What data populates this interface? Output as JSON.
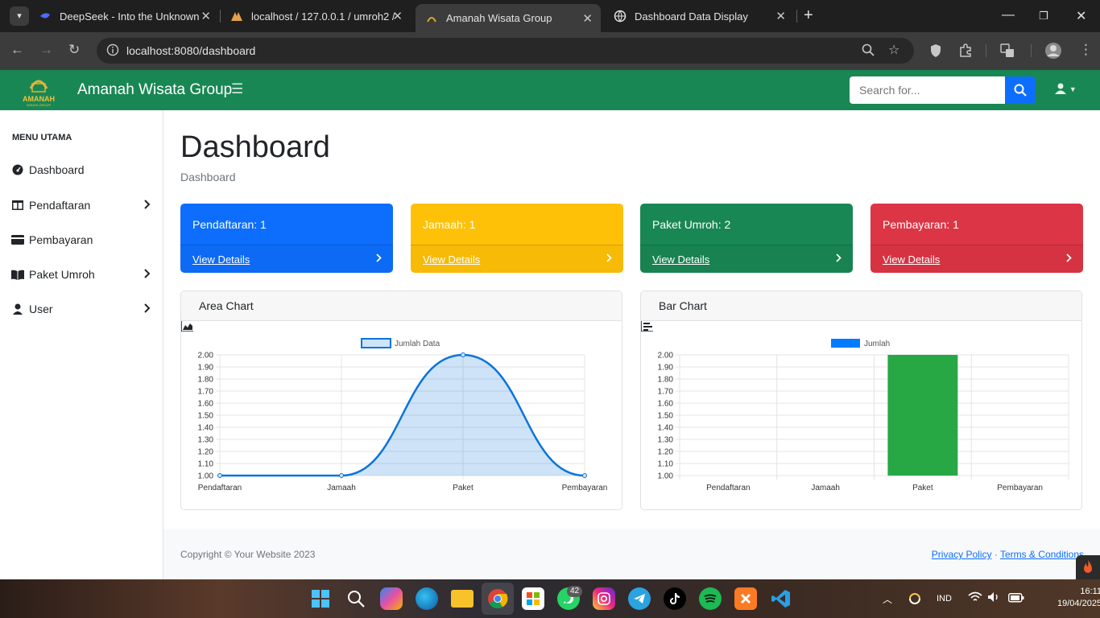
{
  "browser": {
    "tabs": [
      {
        "title": "DeepSeek - Into the Unknown",
        "icon": "deepseek-icon"
      },
      {
        "title": "localhost / 127.0.0.1 / umroh2 /",
        "icon": "phpmyadmin-icon"
      },
      {
        "title": "Amanah Wisata Group",
        "icon": "amanah-icon",
        "active": true
      },
      {
        "title": "Dashboard Data Display",
        "icon": "globe-icon"
      }
    ],
    "url": "localhost:8080/dashboard"
  },
  "navbar": {
    "brand_logo_text": "AMANAH",
    "brand_logo_sub": "WISATA GROUP",
    "brand": "Amanah Wisata Group",
    "search_placeholder": "Search for..."
  },
  "sidebar": {
    "heading": "MENU UTAMA",
    "items": [
      {
        "label": "Dashboard",
        "icon": "dashboard-icon",
        "expandable": false
      },
      {
        "label": "Pendaftaran",
        "icon": "columns-icon",
        "expandable": true
      },
      {
        "label": "Pembayaran",
        "icon": "credit-card-icon",
        "expandable": false
      },
      {
        "label": "Paket Umroh",
        "icon": "book-icon",
        "expandable": true
      },
      {
        "label": "User",
        "icon": "user-icon",
        "expandable": true
      }
    ]
  },
  "main": {
    "title": "Dashboard",
    "breadcrumb": "Dashboard",
    "cards": [
      {
        "title": "Pendaftaran: 1",
        "link": "View Details",
        "color": "#0d6efd"
      },
      {
        "title": "Jamaah: 1",
        "link": "View Details",
        "color": "#ffc107"
      },
      {
        "title": "Paket Umroh: 2",
        "link": "View Details",
        "color": "#198754"
      },
      {
        "title": "Pembayaran: 1",
        "link": "View Details",
        "color": "#dc3545"
      }
    ],
    "area_chart_title": "Area Chart",
    "bar_chart_title": "Bar Chart"
  },
  "chart_data": [
    {
      "type": "area",
      "title": "Area Chart",
      "categories": [
        "Pendaftaran",
        "Jamaah",
        "Paket",
        "Pembayaran"
      ],
      "series": [
        {
          "name": "Jumlah Data",
          "values": [
            1,
            1,
            2,
            1
          ]
        }
      ],
      "ylim": [
        1.0,
        2.0
      ],
      "yticks": [
        "1.00",
        "1.10",
        "1.20",
        "1.30",
        "1.40",
        "1.50",
        "1.60",
        "1.70",
        "1.80",
        "1.90",
        "2.00"
      ],
      "color": "#0a74da",
      "legend": "top-center",
      "grid": true
    },
    {
      "type": "bar",
      "title": "Bar Chart",
      "categories": [
        "Pendaftaran",
        "Jamaah",
        "Paket",
        "Pembayaran"
      ],
      "series": [
        {
          "name": "Jumlah",
          "values": [
            1,
            1,
            2,
            1
          ]
        }
      ],
      "ylim": [
        1.0,
        2.0
      ],
      "yticks": [
        "1.00",
        "1.10",
        "1.20",
        "1.30",
        "1.40",
        "1.50",
        "1.60",
        "1.70",
        "1.80",
        "1.90",
        "2.00"
      ],
      "legend_color": "#007bff",
      "bar_colors": [
        "#007bff",
        "#ffc107",
        "#28a745",
        "#dc3545"
      ],
      "legend": "top-center",
      "grid": true
    }
  ],
  "footer": {
    "copyright": "Copyright © Your Website 2023",
    "privacy": "Privacy Policy",
    "separator": "·",
    "terms": "Terms & Conditions"
  },
  "taskbar": {
    "apps": [
      "windows-start-icon",
      "search-icon",
      "copilot-icon",
      "edge-icon",
      "file-explorer-icon",
      "chrome-icon",
      "store-icon",
      "whatsapp-icon",
      "instagram-icon",
      "telegram-icon",
      "tiktok-icon",
      "spotify-icon",
      "xampp-icon",
      "vscode-icon"
    ],
    "whatsapp_badge": "42",
    "language": "IND",
    "time": "16:11",
    "date": "19/04/2025"
  }
}
